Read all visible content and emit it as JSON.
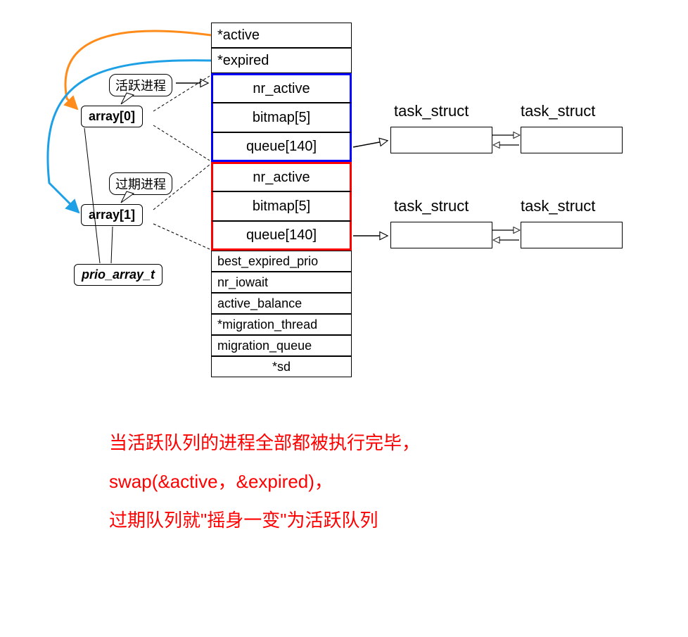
{
  "struct": {
    "active": "*active",
    "expired": "*expired",
    "group1": {
      "nr_active": "nr_active",
      "bitmap": "bitmap[5]",
      "queue": "queue[140]"
    },
    "group2": {
      "nr_active": "nr_active",
      "bitmap": "bitmap[5]",
      "queue": "queue[140]"
    },
    "best_expired_prio": "best_expired_prio",
    "nr_iowait": "nr_iowait",
    "active_balance": "active_balance",
    "migration_thread": "*migration_thread",
    "migration_queue": "migration_queue",
    "sd": "*sd"
  },
  "labels": {
    "active_proc": "活跃进程",
    "expired_proc": "过期进程",
    "array0": "array[0]",
    "array1": "array[1]",
    "prio_array_t": "prio_array_t"
  },
  "task": {
    "label": "task_struct"
  },
  "caption": {
    "line1": "当活跃队列的进程全部都被执行完毕，",
    "line2": "swap(&active，&expired)，",
    "line3": "过期队列就\"摇身一变\"为活跃队列"
  },
  "colors": {
    "blue_box": "#0000ff",
    "red_box": "#ff0000",
    "arrow_orange": "#ff8c1a",
    "arrow_cyan": "#1ea0e6"
  }
}
